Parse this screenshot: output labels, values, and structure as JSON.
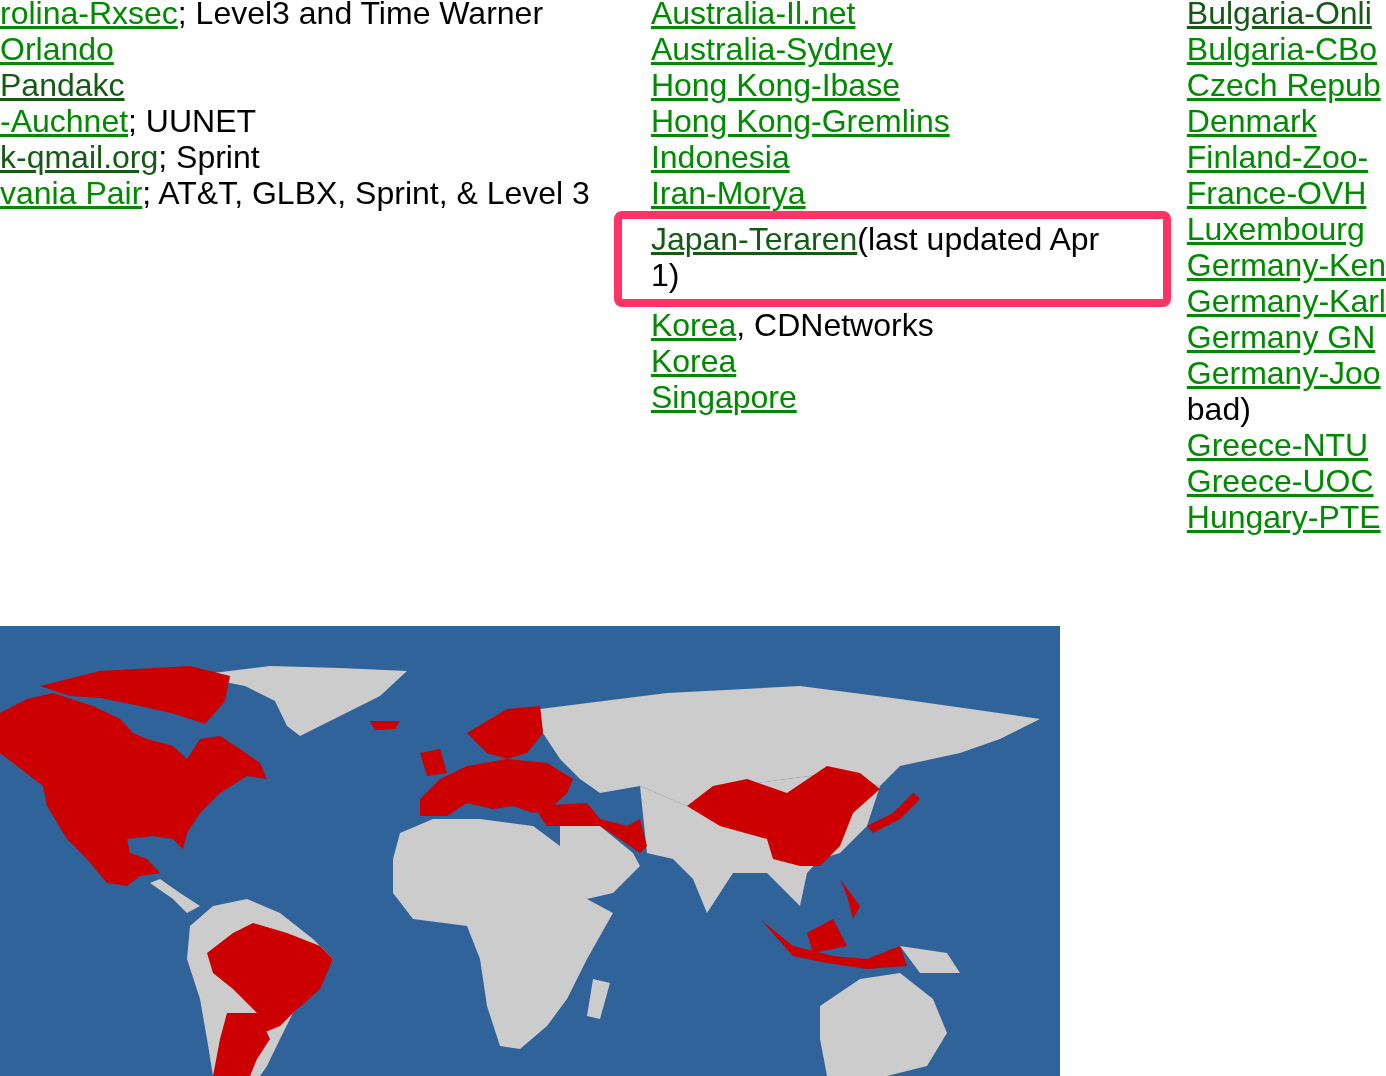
{
  "columns": [
    {
      "items": [
        {
          "link": "rolina-Rxsec",
          "visited": false,
          "highlighted": false,
          "note": "; Level3 and Time Warner"
        },
        {
          "link": "Orlando",
          "visited": false,
          "highlighted": false
        },
        {
          "link": "Pandakc",
          "visited": true,
          "highlighted": false
        },
        {
          "link": "-Auchnet",
          "visited": false,
          "highlighted": false,
          "note": "; UUNET"
        },
        {
          "link": "k-qmail.org",
          "visited": true,
          "highlighted": false,
          "note": "; Sprint"
        },
        {
          "link": "vania Pair",
          "visited": false,
          "highlighted": false,
          "note": "; AT&T, GLBX, Sprint, & Level 3"
        }
      ]
    },
    {
      "items": [
        {
          "link": "Australia-Il.net",
          "visited": false,
          "highlighted": false
        },
        {
          "link": "Australia-Sydney",
          "visited": false,
          "highlighted": false
        },
        {
          "link": "Hong Kong-Ibase",
          "visited": false,
          "highlighted": false
        },
        {
          "link": "Hong Kong-Gremlins",
          "visited": false,
          "highlighted": false
        },
        {
          "link": "Indonesia",
          "visited": false,
          "highlighted": false
        },
        {
          "link": "Iran-Morya",
          "visited": false,
          "highlighted": false
        },
        {
          "link": "Japan-Teraren",
          "visited": true,
          "highlighted": true,
          "note": "(last updated Apr 1)"
        },
        {
          "link": "Korea",
          "visited": false,
          "highlighted": false,
          "note": ", CDNetworks"
        },
        {
          "link": "Korea",
          "visited": false,
          "highlighted": false
        },
        {
          "link": "Singapore",
          "visited": false,
          "highlighted": false
        }
      ]
    },
    {
      "items": [
        {
          "link": "Bulgaria-Onli",
          "visited": true,
          "highlighted": false
        },
        {
          "link": "Bulgaria-CBo",
          "visited": false,
          "highlighted": false
        },
        {
          "link": "Czech Repub",
          "visited": false,
          "highlighted": false
        },
        {
          "link": "Denmark",
          "visited": false,
          "highlighted": false
        },
        {
          "link": "Finland-Zoo-",
          "visited": false,
          "highlighted": false
        },
        {
          "link": "France-OVH",
          "visited": false,
          "highlighted": false
        },
        {
          "link": "Luxembourg",
          "visited": false,
          "highlighted": false
        },
        {
          "link": "Germany-Ken",
          "visited": false,
          "highlighted": false
        },
        {
          "link": "Germany-Karl",
          "visited": false,
          "highlighted": false
        },
        {
          "link": "Germany GN",
          "visited": false,
          "highlighted": false
        },
        {
          "link": "Germany-Joo",
          "visited": false,
          "highlighted": false,
          "continued": "bad)"
        },
        {
          "link": "Greece-NTU",
          "visited": false,
          "highlighted": false
        },
        {
          "link": "Greece-UOC",
          "visited": false,
          "highlighted": false
        },
        {
          "link": "Hungary-PTE",
          "visited": false,
          "highlighted": false
        }
      ]
    }
  ]
}
